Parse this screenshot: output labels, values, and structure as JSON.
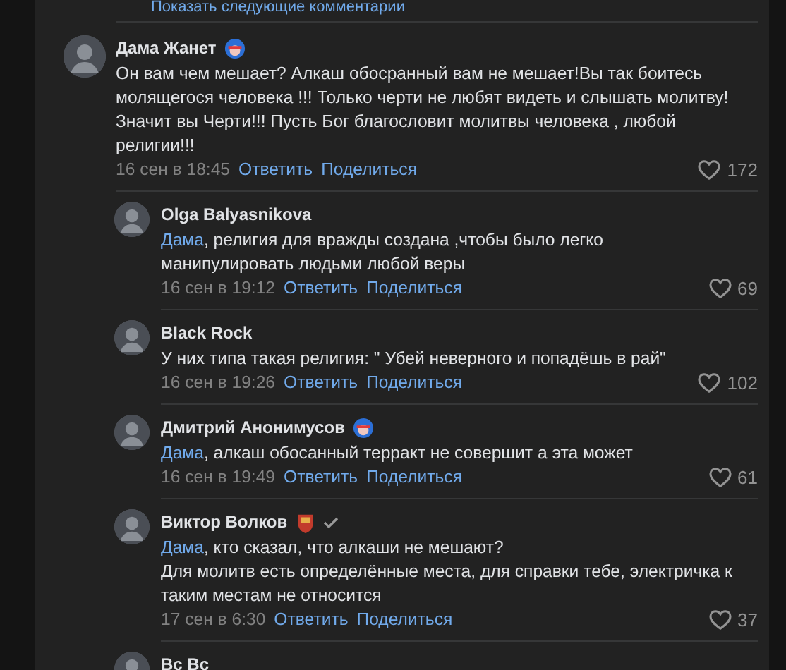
{
  "more_comments_link": "Показать следующие комментарии",
  "comment": {
    "author": "Дама Жанет",
    "badge": {
      "kind": "shield"
    },
    "verified": false,
    "text": "Он вам чем мешает? Алкаш обосранный вам не мешает!Вы так боитесь\nмолящегося человека !!! Только черти не любят видеть и слышать молитву!\nЗначит вы Черти!!! Пусть Бог благословит молитвы человека , любой\nрелигии!!!",
    "date": "16 сен в 18:45",
    "reply": "Ответить",
    "share": "Поделиться",
    "likes": "172",
    "replies": [
      {
        "author": "Olga Balyasnikova",
        "verified": false,
        "mention": "Дама",
        "text": ", религия для вражды создана ,чтобы было легко\nманипулировать людьми любой веры",
        "date": "16 сен в 19:12",
        "reply": "Ответить",
        "share": "Поделиться",
        "likes": "69"
      },
      {
        "author": "Black Rock",
        "verified": false,
        "text": "У них типа такая религия: \" Убей неверного и попадёшь в рай\"",
        "date": "16 сен в 19:26",
        "reply": "Ответить",
        "share": "Поделиться",
        "likes": "102"
      },
      {
        "author": "Дмитрий Анонимусов",
        "badge": {
          "kind": "shield"
        },
        "verified": false,
        "mention": "Дама",
        "text": ", алкаш обосанный терракт не совершит а эта может",
        "date": "16 сен в 19:49",
        "reply": "Ответить",
        "share": "Поделиться",
        "likes": "61"
      },
      {
        "author": "Виктор Волков",
        "badge": {
          "kind": "crest"
        },
        "verified": true,
        "mention": "Дама",
        "text": ", кто сказал, что алкаши не мешают?\nДля молитв есть определённые места, для справки тебе, электричка к\nтаким местам не относится",
        "date": "17 сен в 6:30",
        "reply": "Ответить",
        "share": "Поделиться",
        "likes": "37"
      },
      {
        "author": "Вс Вс",
        "verified": false
      }
    ]
  }
}
